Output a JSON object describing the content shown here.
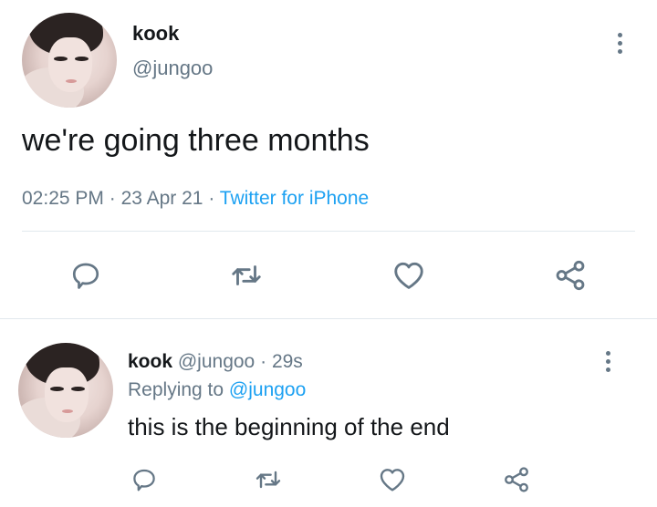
{
  "main_tweet": {
    "display_name": "kook",
    "handle": "@jungoo",
    "text": "we're going three months",
    "time": "02:25 PM",
    "separator1": "·",
    "date": "23 Apr 21",
    "separator2": "·",
    "source": "Twitter for iPhone"
  },
  "reply_tweet": {
    "display_name": "kook",
    "handle": "@jungoo",
    "separator": "·",
    "age": "29s",
    "replying_prefix": "Replying to",
    "replying_handle": "@jungoo",
    "text": "this is the beginning of the end"
  },
  "icons": {
    "reply": "reply-icon",
    "retweet": "retweet-icon",
    "like": "heart-icon",
    "share": "share-icon",
    "more": "more-vertical-icon"
  },
  "colors": {
    "text": "#14171a",
    "secondary": "#657786",
    "accent": "#1da1f2",
    "divider": "#e1e8ed"
  }
}
